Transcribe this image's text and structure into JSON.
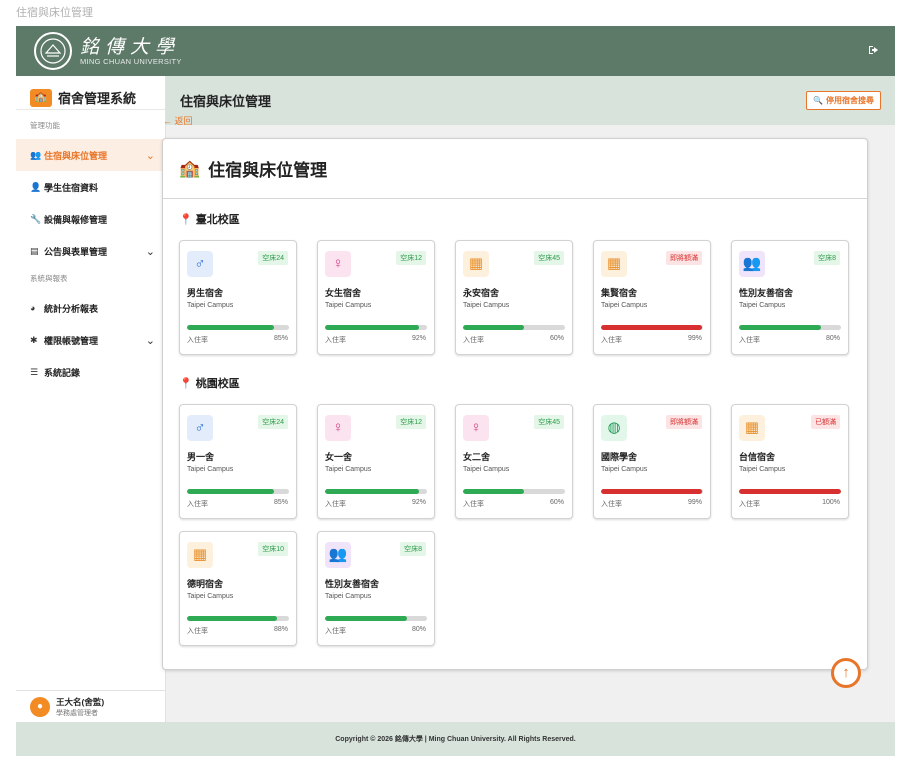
{
  "page_title": "住宿與床位管理",
  "brand": {
    "name_zh": "銘傳大學",
    "name_en": "MING CHUAN UNIVERSITY",
    "logo_icon": "university-seal-icon",
    "logout_icon": "logout-icon"
  },
  "sidebar": {
    "system_name": "宿舍管理系統",
    "system_icon": "school-icon",
    "section_manage": "管理功能",
    "section_report": "系統與報表",
    "items": [
      {
        "label": "住宿與床位管理",
        "icon": "users-icon",
        "active": true,
        "expandable": true
      },
      {
        "label": "學生住宿資料",
        "icon": "user-icon",
        "active": false,
        "expandable": false
      },
      {
        "label": "設備與報修管理",
        "icon": "wrench-icon",
        "active": false,
        "expandable": false
      },
      {
        "label": "公告與表單管理",
        "icon": "document-icon",
        "active": false,
        "expandable": true
      },
      {
        "label": "統計分析報表",
        "icon": "pie-chart-icon",
        "active": false,
        "expandable": false
      },
      {
        "label": "權限帳號管理",
        "icon": "gear-icon",
        "active": false,
        "expandable": true
      },
      {
        "label": "系統記錄",
        "icon": "list-icon",
        "active": false,
        "expandable": false
      }
    ],
    "user": {
      "name": "王大名(舍監)",
      "role": "學務處管理者"
    }
  },
  "header": {
    "title": "住宿與床位管理",
    "disabled_search_label": "停用宿舍搜尋"
  },
  "back_label": "返回",
  "panel_title": "住宿與床位管理",
  "campuses": [
    {
      "name": "臺北校區",
      "dorms": [
        {
          "name": "男生宿舍",
          "campus_en": "Taipei Campus",
          "badge": "空床24",
          "status": "ok",
          "occupancy_label": "入住率",
          "occupancy": "85%",
          "fill": 85,
          "icon": "male-icon"
        },
        {
          "name": "女生宿舍",
          "campus_en": "Taipei Campus",
          "badge": "空床12",
          "status": "ok",
          "occupancy_label": "入住率",
          "occupancy": "92%",
          "fill": 92,
          "icon": "female-icon"
        },
        {
          "name": "永安宿舍",
          "campus_en": "Taipei Campus",
          "badge": "空床45",
          "status": "ok",
          "occupancy_label": "入住率",
          "occupancy": "60%",
          "fill": 60,
          "icon": "building-icon"
        },
        {
          "name": "集賢宿舍",
          "campus_en": "Taipei Campus",
          "badge": "即將額滿",
          "status": "warn",
          "occupancy_label": "入住率",
          "occupancy": "99%",
          "fill": 99,
          "icon": "building-icon"
        },
        {
          "name": "性別友善宿舍",
          "campus_en": "Taipei Campus",
          "badge": "空床8",
          "status": "ok",
          "occupancy_label": "入住率",
          "occupancy": "80%",
          "fill": 80,
          "icon": "users-icon"
        }
      ]
    },
    {
      "name": "桃園校區",
      "dorms": [
        {
          "name": "男一舍",
          "campus_en": "Taipei Campus",
          "badge": "空床24",
          "status": "ok",
          "occupancy_label": "入住率",
          "occupancy": "85%",
          "fill": 85,
          "icon": "male-icon"
        },
        {
          "name": "女一舍",
          "campus_en": "Taipei Campus",
          "badge": "空床12",
          "status": "ok",
          "occupancy_label": "入住率",
          "occupancy": "92%",
          "fill": 92,
          "icon": "female-icon"
        },
        {
          "name": "女二舍",
          "campus_en": "Taipei Campus",
          "badge": "空床45",
          "status": "ok",
          "occupancy_label": "入住率",
          "occupancy": "60%",
          "fill": 60,
          "icon": "female-icon"
        },
        {
          "name": "國際學舍",
          "campus_en": "Taipei Campus",
          "badge": "即將額滿",
          "status": "warn",
          "occupancy_label": "入住率",
          "occupancy": "99%",
          "fill": 99,
          "icon": "globe-icon"
        },
        {
          "name": "台信宿舍",
          "campus_en": "Taipei Campus",
          "badge": "已額滿",
          "status": "warn",
          "occupancy_label": "入住率",
          "occupancy": "100%",
          "fill": 100,
          "icon": "building-icon"
        },
        {
          "name": "德明宿舍",
          "campus_en": "Taipei Campus",
          "badge": "空床10",
          "status": "ok",
          "occupancy_label": "入住率",
          "occupancy": "88%",
          "fill": 88,
          "icon": "building-icon"
        },
        {
          "name": "性別友善宿舍",
          "campus_en": "Taipei Campus",
          "badge": "空床8",
          "status": "ok",
          "occupancy_label": "入住率",
          "occupancy": "80%",
          "fill": 80,
          "icon": "users-icon"
        }
      ]
    }
  ],
  "footer": "Copyright © 2026 銘傳大學 | Ming Chuan University. All Rights Reserved.",
  "colors": {
    "brand_green": "#5d7968",
    "accent_orange": "#e8762a",
    "bar_green": "#2eaa55",
    "bar_red": "#d83030"
  }
}
